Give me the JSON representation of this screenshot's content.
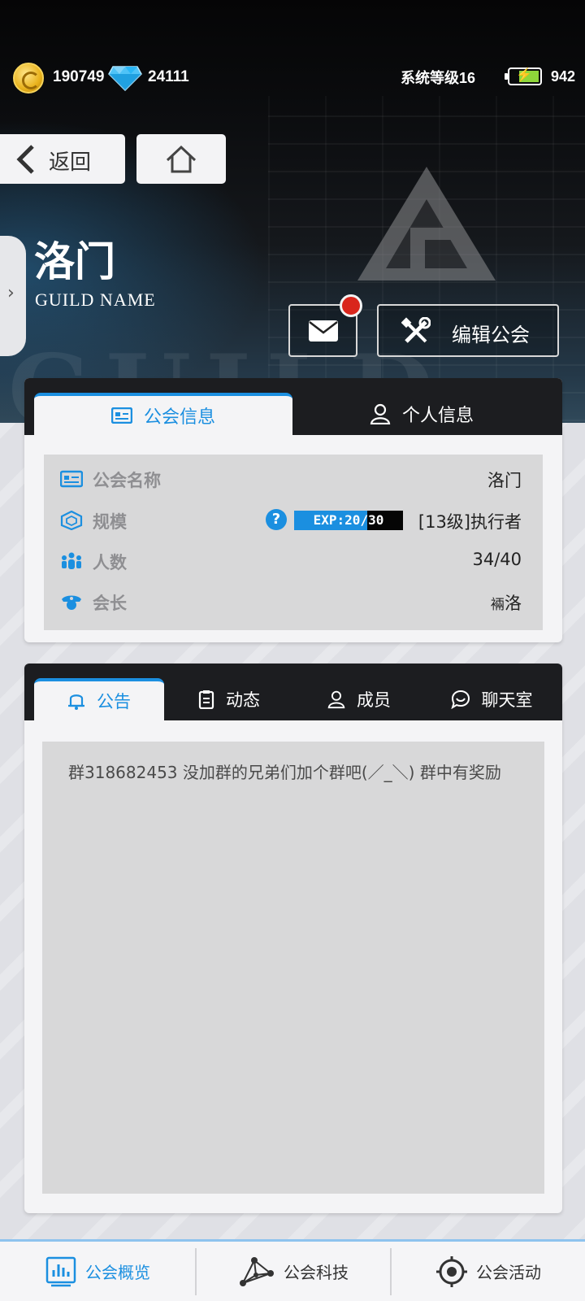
{
  "statusbar": {
    "coins": "190749",
    "gems": "24111",
    "system_level": "系统等级16",
    "battery": "942"
  },
  "nav": {
    "back_label": "返回"
  },
  "guild": {
    "name": "洛门",
    "subtitle": "GUILD NAME",
    "edit_label": "编辑公会",
    "has_new_mail": true
  },
  "info_tabs": [
    {
      "label": "公会信息",
      "icon": "id-card-icon",
      "active": true
    },
    {
      "label": "个人信息",
      "icon": "person-icon",
      "active": false
    }
  ],
  "info_rows": {
    "name": {
      "label": "公会名称",
      "icon": "id-card-icon",
      "value": "洛门"
    },
    "scale": {
      "label": "规模",
      "icon": "cube-icon",
      "exp_text": "EXP:20/30",
      "exp_fraction": 0.67,
      "rank": "[13级]执行者"
    },
    "members": {
      "label": "人数",
      "icon": "people-icon",
      "value": "34/40"
    },
    "leader": {
      "label": "会长",
      "icon": "leader-badge-icon",
      "value_prefix": "裲",
      "value": "洛"
    }
  },
  "announce_tabs": [
    {
      "label": "公告",
      "icon": "bell-icon",
      "active": true
    },
    {
      "label": "动态",
      "icon": "clipboard-icon",
      "active": false
    },
    {
      "label": "成员",
      "icon": "person-icon",
      "active": false
    },
    {
      "label": "聊天室",
      "icon": "chat-icon",
      "active": false
    }
  ],
  "announcement": {
    "text": "群318682453  没加群的兄弟们加个群吧(／_＼) 群中有奖励"
  },
  "bottom_nav": [
    {
      "label": "公会概览",
      "icon": "chart-icon",
      "active": true
    },
    {
      "label": "公会科技",
      "icon": "network-icon",
      "active": false
    },
    {
      "label": "公会活动",
      "icon": "target-icon",
      "active": false
    }
  ],
  "colors": {
    "accent": "#1b8fe0",
    "dark_header": "#1c1d20",
    "panel_bg": "#f4f4f6",
    "row_bg": "#d8d8d9",
    "notification": "#d9261c"
  }
}
